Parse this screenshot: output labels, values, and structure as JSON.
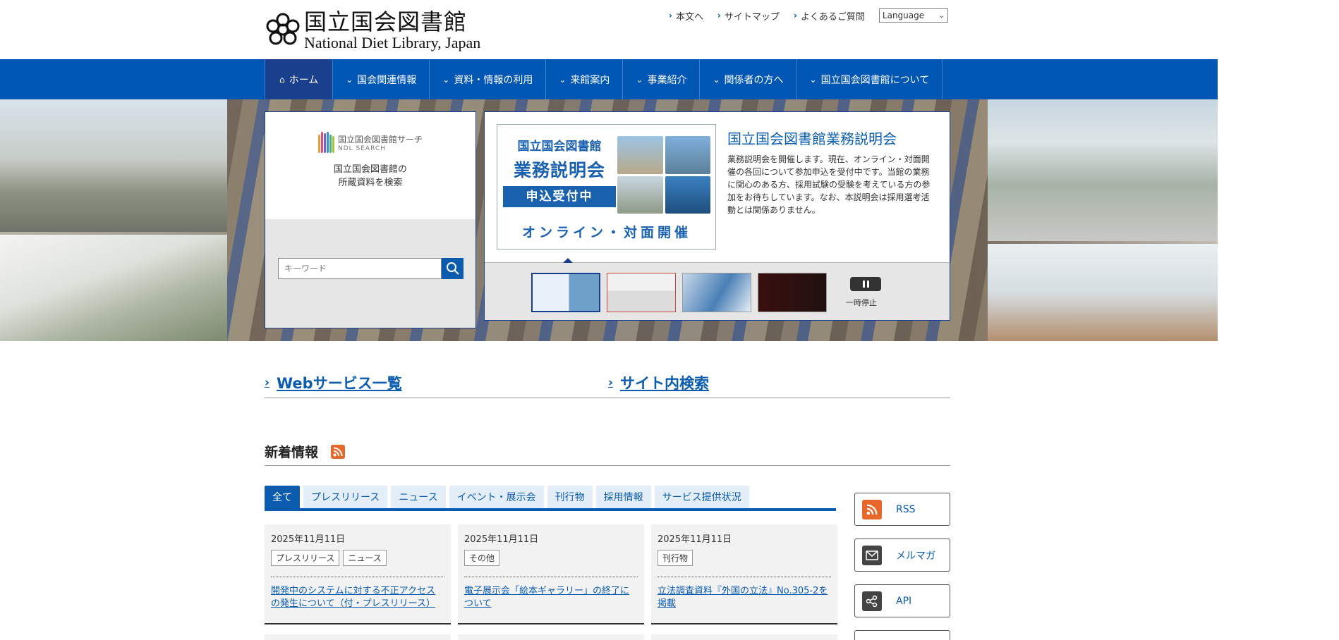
{
  "header": {
    "logo_jp": "国立国会図書館",
    "logo_en": "National Diet Library, Japan",
    "util_links": [
      "本文へ",
      "サイトマップ",
      "よくあるご質問"
    ],
    "language_select": "Language"
  },
  "nav": {
    "items": [
      "ホーム",
      "国会関連情報",
      "資料・情報の利用",
      "来館案内",
      "事業紹介",
      "関係者の方へ",
      "国立国会図書館について"
    ]
  },
  "search_panel": {
    "logo_title": "国立国会図書館サーチ",
    "logo_sub": "NDL SEARCH",
    "desc_line1": "国立国会図書館の",
    "desc_line2": "所蔵資料を検索",
    "placeholder": "キーワード"
  },
  "slide": {
    "banner_line1": "国立国会図書館",
    "banner_line2": "業務説明会",
    "banner_line3": "申込受付中",
    "banner_line4": "オンライン・対面開催",
    "title": "国立国会図書館業務説明会",
    "text": "業務説明会を開催します。現在、オンライン・対面開催の各回について参加申込を受付中です。当館の業務に関心のある方、採用試験の受験を考えている方の参加をお待ちしています。なお、本説明会は採用選考活動とは関係ありません。",
    "pause_label": "一時停止"
  },
  "links": {
    "web_services": "Webサービス一覧",
    "site_search": "サイト内検索"
  },
  "news": {
    "heading": "新着情報",
    "tabs": [
      "全て",
      "プレスリリース",
      "ニュース",
      "イベント・展示会",
      "刊行物",
      "採用情報",
      "サービス提供状況"
    ],
    "items": [
      {
        "date": "2025年11月11日",
        "tags": [
          "プレスリリース",
          "ニュース"
        ],
        "title": "開発中のシステムに対する不正アクセスの発生について（付・プレスリリース）"
      },
      {
        "date": "2025年11月11日",
        "tags": [
          "その他"
        ],
        "title": "電子展示会「絵本ギャラリー」の終了について"
      },
      {
        "date": "2025年11月11日",
        "tags": [
          "刊行物"
        ],
        "title": "立法調査資料『外国の立法』No.305-2を掲載"
      }
    ]
  },
  "side": {
    "rss": "RSS",
    "mailmag": "メルマガ",
    "api": "API"
  },
  "colors": {
    "nav_blue": "#0056b3",
    "nav_active": "#1a3f8c",
    "link_blue": "#0b5cae",
    "rss_orange": "#e8672a"
  }
}
